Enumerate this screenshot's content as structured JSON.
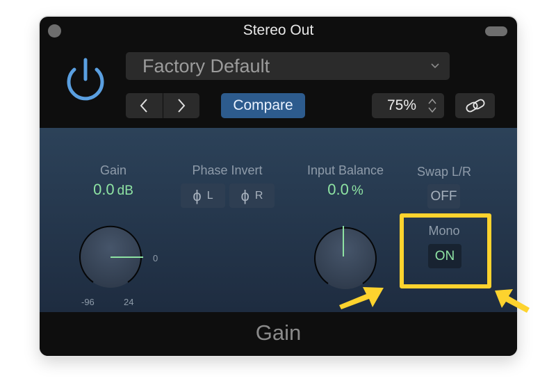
{
  "window": {
    "title": "Stereo Out",
    "close_icon": "circle-button-icon",
    "collapse_icon": "pill-button-icon"
  },
  "header": {
    "power_icon": "power-icon",
    "power_color": "#5a9fe0",
    "preset": {
      "value": "Factory Default",
      "icon": "chevron-down-icon"
    },
    "nav": {
      "prev_icon": "chevron-left-icon",
      "next_icon": "chevron-right-icon"
    },
    "compare_label": "Compare",
    "compare_color": "#2d5b8d",
    "zoom": {
      "value": "75%",
      "icon": "stepper-icon"
    },
    "link_icon": "link-icon"
  },
  "controls": {
    "gain": {
      "label": "Gain",
      "value": "0.0",
      "unit": "dB",
      "min_label": "-96",
      "max_label": "24",
      "center_label": "0"
    },
    "phase_invert": {
      "label": "Phase Invert",
      "left_label": "L",
      "right_label": "R",
      "phase_icon": "phi-icon"
    },
    "input_balance": {
      "label": "Input Balance",
      "value": "0.0",
      "unit": "%"
    },
    "swap_lr": {
      "label": "Swap L/R",
      "state": "OFF"
    },
    "mono": {
      "label": "Mono",
      "state": "ON"
    }
  },
  "annotation": {
    "highlight_color": "#fdd32e",
    "arrow_icon": "arrow-icon"
  },
  "footer": {
    "label": "Gain"
  },
  "colors": {
    "value_green": "#8ee3a3",
    "panel_top": "#2c4259",
    "panel_bottom": "#1e2c40"
  }
}
